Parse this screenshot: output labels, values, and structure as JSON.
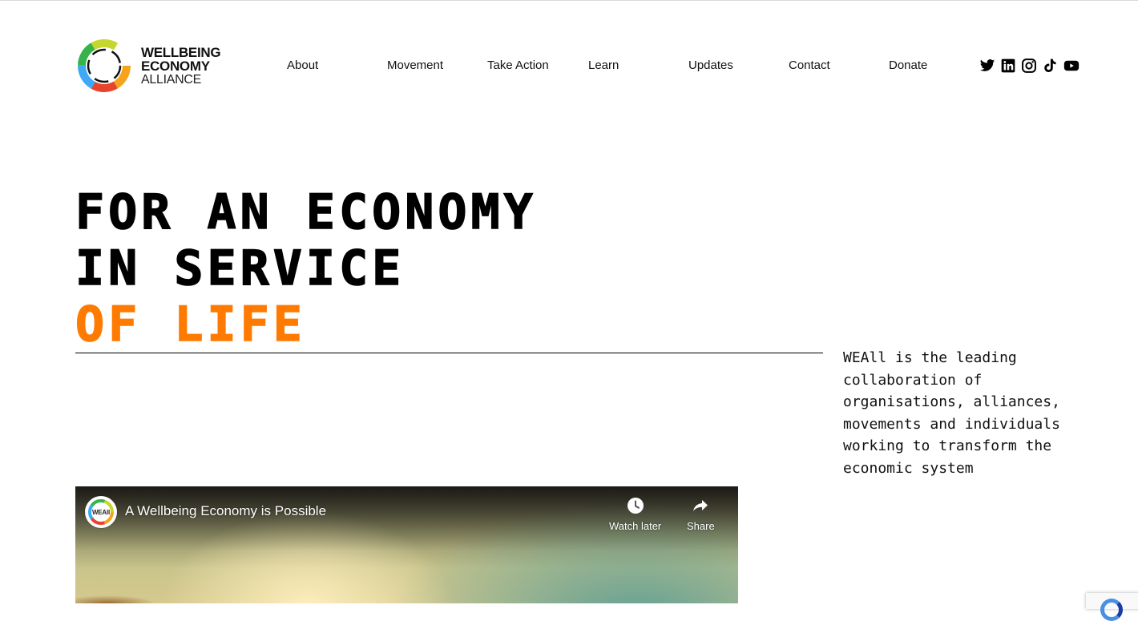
{
  "header": {
    "logo": {
      "line1": "WELLBEING",
      "line2": "ECONOMY",
      "line3": "ALLIANCE"
    },
    "nav": [
      {
        "label": "About"
      },
      {
        "label": "Movement"
      },
      {
        "label": "Take Action"
      },
      {
        "label": "Learn"
      },
      {
        "label": "Updates"
      },
      {
        "label": "Contact"
      },
      {
        "label": "Donate"
      }
    ],
    "social": [
      "twitter-icon",
      "linkedin-icon",
      "instagram-icon",
      "tiktok-icon",
      "youtube-icon"
    ]
  },
  "hero": {
    "title_line1": "For an economy",
    "title_line2": "in service",
    "title_line3": "of life",
    "tagline": "WEAll is the leading collaboration of organisations, alliances, movements and individuals working to transform the economic system"
  },
  "video": {
    "channel_label": "WEAll",
    "title": "A Wellbeing Economy is Possible",
    "watch_later": "Watch later",
    "share": "Share"
  },
  "colors": {
    "accent": "#ff7a00",
    "text": "#000000"
  }
}
